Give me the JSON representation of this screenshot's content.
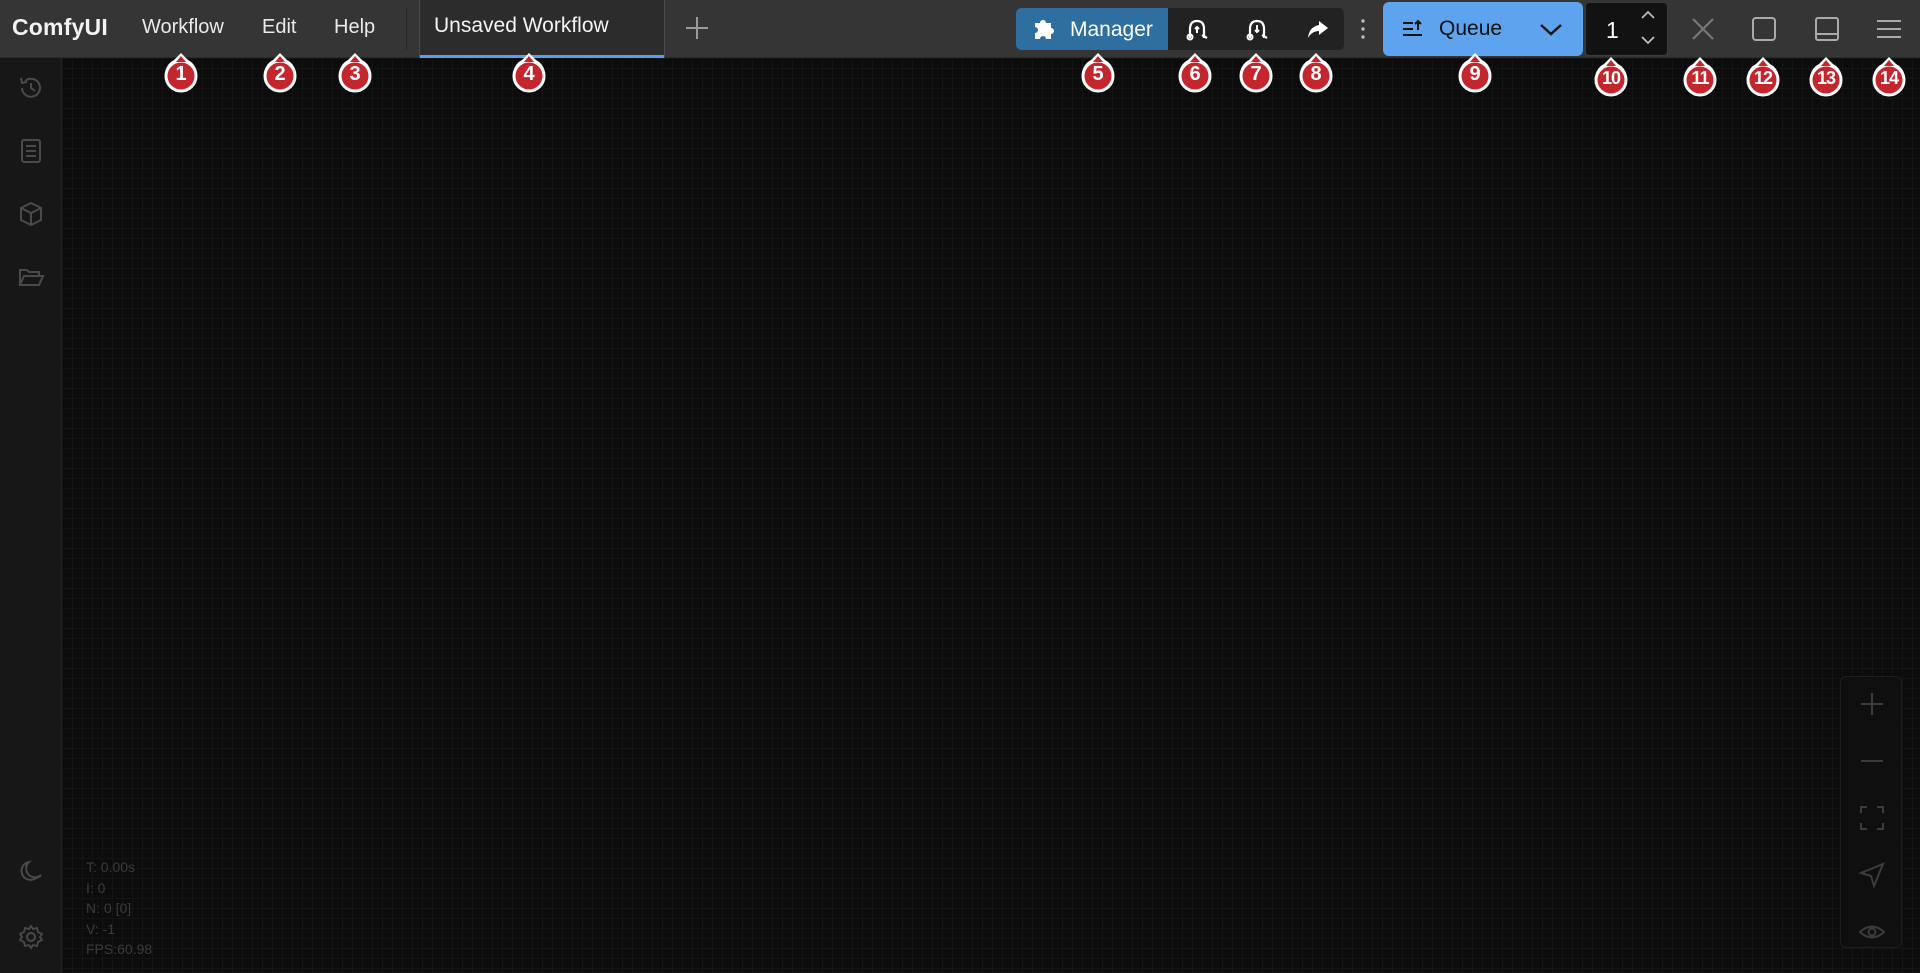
{
  "app": {
    "name": "ComfyUI"
  },
  "menu": {
    "items": [
      "Workflow",
      "Edit",
      "Help"
    ]
  },
  "tabs": [
    {
      "label": "Unsaved Workflow",
      "active": true
    }
  ],
  "toolbar": {
    "manager_label": "Manager",
    "icons": [
      "puzzle-icon",
      "pin-icon",
      "pin-alt-icon",
      "share-icon"
    ]
  },
  "queue": {
    "label": "Queue",
    "count": "1"
  },
  "stats": {
    "time": "T: 0.00s",
    "i": "I: 0",
    "n": "N: 0 [0]",
    "v": "V: -1",
    "fps": "FPS:60.98"
  },
  "markers": [
    "1",
    "2",
    "3",
    "4",
    "5",
    "6",
    "7",
    "8",
    "9",
    "10",
    "11",
    "12",
    "13",
    "14"
  ],
  "colors": {
    "accent": "#5da3ee",
    "manager": "#2f6fa0",
    "marker": "#c4262e",
    "topbar": "#353535",
    "canvas": "#0c0c0c"
  }
}
